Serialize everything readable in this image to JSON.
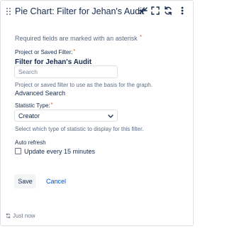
{
  "header": {
    "title": "Pie Chart: Filter for Jehan's Audit",
    "icons": [
      "collapse-icon",
      "maximize-icon",
      "refresh-icon",
      "more-options-icon"
    ]
  },
  "form": {
    "required_note": "Required fields are marked with an asterisk",
    "required_marker": "*",
    "project_filter": {
      "label": "Project or Saved Filter:",
      "selected_name": "Filter for Jehan's Audit",
      "search_placeholder": "Search",
      "help": "Project or saved filter to use as the basis for the graph.",
      "advanced_link": "Advanced Search"
    },
    "statistic_type": {
      "label": "Statistic Type:",
      "selected": "Creator",
      "help": "Select which type of statistic to display for this filter."
    },
    "auto_refresh": {
      "label": "Auto refresh",
      "checkbox_label": "Update every 15 minutes",
      "checked": false
    },
    "save_label": "Save",
    "cancel_label": "Cancel"
  },
  "footer": {
    "status_text": "Just now"
  },
  "colors": {
    "link": "#0052cc",
    "required": "#de350b",
    "text": "#172b4d",
    "muted": "#5e6c84",
    "border": "#dfe1e6"
  }
}
